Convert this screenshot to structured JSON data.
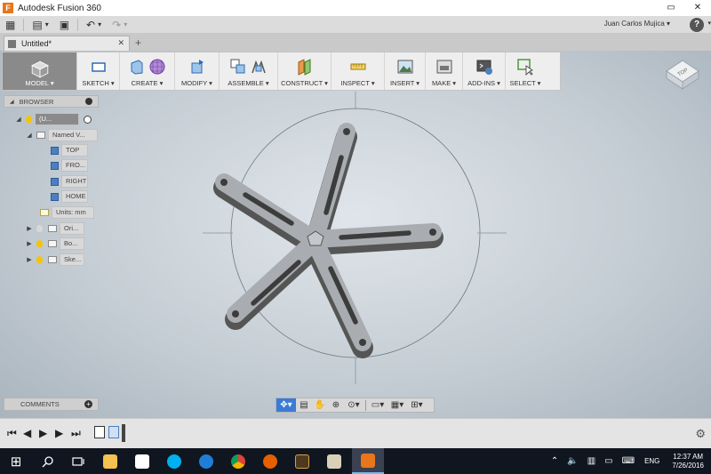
{
  "window": {
    "title": "Autodesk Fusion 360",
    "logo_letter": "F",
    "minimize": "▭",
    "close": "✕"
  },
  "qat": {
    "grid": "▦",
    "file": "▤",
    "caret": "▾",
    "save": "▣",
    "undo": "↶",
    "redo": "↷",
    "user": "Juan Carlos Mujica ▾",
    "help": "?",
    "help_caret": "▾"
  },
  "tabs": {
    "doc_name": "Untitled*",
    "close": "✕",
    "new_tab": "+"
  },
  "toolbar": {
    "groups": [
      {
        "label": "MODEL ▾"
      },
      {
        "label": "SKETCH ▾"
      },
      {
        "label": "CREATE ▾"
      },
      {
        "label": "MODIFY ▾"
      },
      {
        "label": "ASSEMBLE ▾"
      },
      {
        "label": "CONSTRUCT ▾"
      },
      {
        "label": "INSPECT ▾"
      },
      {
        "label": "INSERT ▾"
      },
      {
        "label": "MAKE ▾"
      },
      {
        "label": "ADD-INS ▾"
      },
      {
        "label": "SELECT ▾"
      }
    ]
  },
  "viewcube": {
    "label": "TOP"
  },
  "browser": {
    "header": "BROWSER",
    "collapse": "◢",
    "items": [
      {
        "label": "(U...",
        "expand": "◢"
      },
      {
        "label": "Named V...",
        "expand": "◢"
      },
      {
        "label": "TOP"
      },
      {
        "label": "FRO..."
      },
      {
        "label": "RIGHT"
      },
      {
        "label": "HOME"
      },
      {
        "label": "Units: mm"
      },
      {
        "label": "Ori...",
        "expand": "▶"
      },
      {
        "label": "Bo...",
        "expand": "▶"
      },
      {
        "label": "Ske...",
        "expand": "▶"
      }
    ]
  },
  "comments": {
    "label": "COMMENTS",
    "plus": "+"
  },
  "navbar": {
    "orbit": "✥▾",
    "look": "▤",
    "pan": "✋",
    "zoom": "⊕",
    "fit": "⊙▾",
    "display": "▭▾",
    "grid": "▦▾",
    "viewports": "⊞▾"
  },
  "timeline": {
    "first": "⏮",
    "prev": "◀",
    "play": "▶",
    "next": "▶",
    "last": "⏭",
    "settings": "⚙"
  },
  "taskbar": {
    "start": "⊞",
    "tray_up": "⌃",
    "volume": "🔈",
    "network": "▥",
    "message": "▭",
    "keyboard": "⌨",
    "lang": "ENG",
    "time": "12:37 AM",
    "date": "7/26/2016"
  }
}
